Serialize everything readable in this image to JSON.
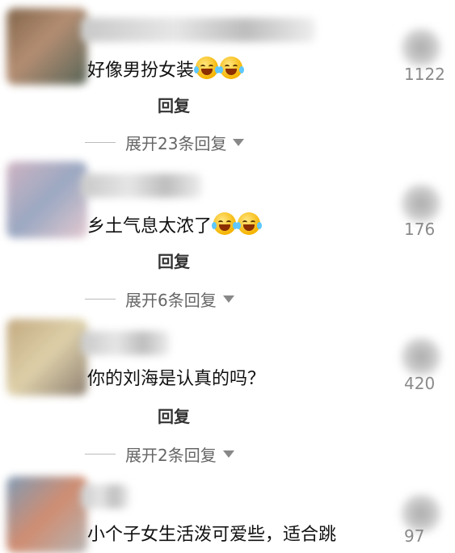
{
  "comments": [
    {
      "text": "好像男扮女装",
      "emoji_icon": "laugh-crying-emoji",
      "emoji_count": 2,
      "reply_label": "回复",
      "expand_label": "展开23条回复",
      "like_count": "1122",
      "avatar_colors": [
        "#6b4a2a",
        "#a77a5a",
        "#3b4a3b"
      ]
    },
    {
      "text": "乡土气息太浓了",
      "emoji_icon": "laugh-crying-emoji",
      "emoji_count": 2,
      "reply_label": "回复",
      "expand_label": "展开6条回复",
      "like_count": "176",
      "avatar_colors": [
        "#c7a7b8",
        "#8a9ab8",
        "#e0c0c8"
      ]
    },
    {
      "text": "你的刘海是认真的吗？",
      "emoji_icon": "",
      "emoji_count": 0,
      "reply_label": "回复",
      "expand_label": "展开2条回复",
      "like_count": "420",
      "avatar_colors": [
        "#b89a6a",
        "#d8c89a",
        "#7a6a5a"
      ]
    },
    {
      "text": "小个子女生活泼可爱些，适合跳",
      "emoji_icon": "",
      "emoji_count": 0,
      "reply_label": "",
      "expand_label": "",
      "like_count": "97",
      "avatar_colors": [
        "#6a8aa8",
        "#c87a5a",
        "#a8a8a8"
      ]
    }
  ]
}
